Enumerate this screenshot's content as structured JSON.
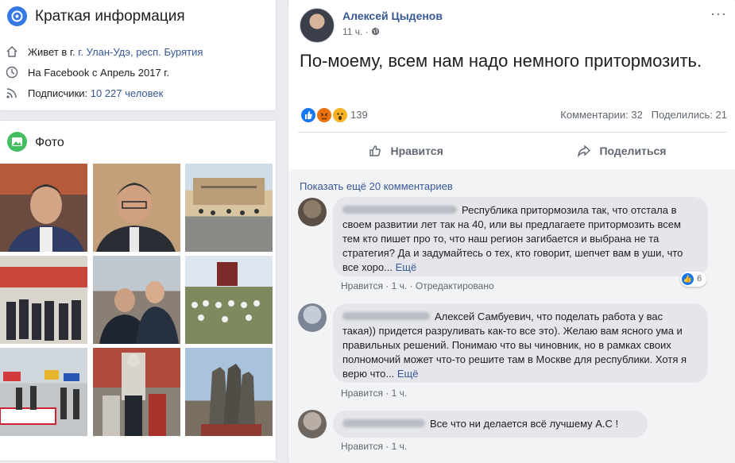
{
  "intro": {
    "title": "Краткая информация",
    "lives_prefix": "Живет в г. ",
    "lives_link": "г. Улан-Удэ, респ. Бурятия",
    "joined": "На Facebook с Апрель 2017 г.",
    "followers_prefix": "Подписчики: ",
    "followers_link": "10 227 человек"
  },
  "photos": {
    "title": "Фото"
  },
  "post": {
    "author": "Алексей Цыденов",
    "time": "11 ч. ·",
    "text": "По-моему, всем нам надо немного притормозить.",
    "reaction_count": "139",
    "comments": "Комментарии: 32",
    "shares": "Поделились: 21",
    "like_label": "Нравится",
    "share_label": "Поделиться",
    "show_more": "Показать ещё 20 комментариев",
    "more_dots": "···"
  },
  "comments": [
    {
      "text": "Республика притормозила так, что отстала в своем развитии лет так на 40, или вы предлагаете притормозить всем тем кто пишет про то, что наш регион загибается и выбрана не та стратегия? Да и задумайтесь о тех, кто говорит, шепчет вам в уши, что все хоро...",
      "more": "Ещё",
      "like": "Нравится",
      "time": "1 ч.",
      "edited": "Отредактировано",
      "likes": "6"
    },
    {
      "text": "Алексей Самбуевич, что поделать работа у вас такая)) придется разруливать как-то все это). Желаю вам ясного ума и правильных решений. Понимаю что вы чиновник, но в рамках своих полномочий может что-то решите там в Москве для республики. Хотя я верю что...",
      "more": "Ещё",
      "like": "Нравится",
      "time": "1 ч."
    },
    {
      "text": "Все что ни делается всё лучшему А.С !",
      "like": "Нравится",
      "time": "1 ч."
    }
  ],
  "colors": {
    "link": "#385898",
    "like_blue": "#1877f2",
    "angry": "#e9710f",
    "wow": "#f7b125"
  }
}
